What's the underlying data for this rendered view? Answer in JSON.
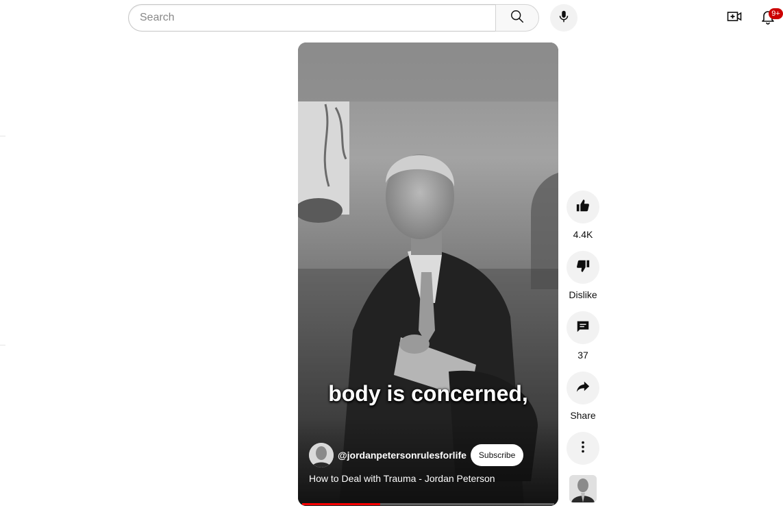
{
  "header": {
    "search": {
      "placeholder": "Search",
      "value": ""
    },
    "search_button_icon": "search-icon",
    "mic_icon": "microphone-icon",
    "create_icon": "video-plus-icon",
    "notifications": {
      "icon": "bell-icon",
      "badge": "9+",
      "badge_color": "#cc0000"
    }
  },
  "player": {
    "caption": "body is concerned,",
    "channel": {
      "handle": "@jordanpetersonrulesforlife",
      "subscribe_label": "Subscribe"
    },
    "title": "How to Deal with Trauma - Jordan Peterson",
    "progress": 0.31,
    "progress_color": "#ff0000"
  },
  "actions": {
    "like": {
      "icon": "thumbs-up-icon",
      "label": "4.4K"
    },
    "dislike": {
      "icon": "thumbs-down-icon",
      "label": "Dislike"
    },
    "comments": {
      "icon": "comment-icon",
      "label": "37"
    },
    "share": {
      "icon": "share-arrow-icon",
      "label": "Share"
    },
    "more": {
      "icon": "more-vertical-icon"
    }
  }
}
